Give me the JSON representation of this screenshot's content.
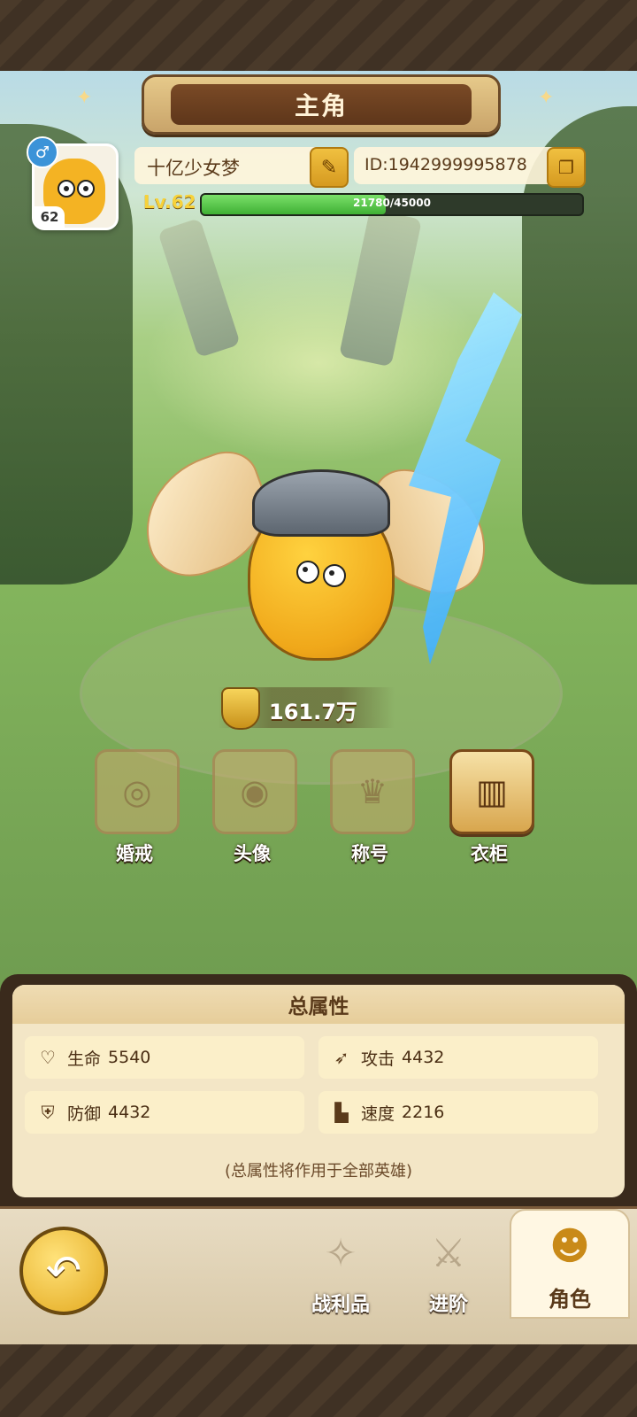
{
  "screen_title": "主角",
  "profile": {
    "name": "十亿少女梦",
    "id_text": "ID:1942999995878",
    "level_label": "Lv.62",
    "avatar_level": "62",
    "gender_symbol": "♂",
    "xp_text": "21780/45000",
    "xp_fraction": 0.484
  },
  "power": {
    "value": "161.7万"
  },
  "features": [
    {
      "label": "婚戒",
      "icon": "ring-icon",
      "active": false
    },
    {
      "label": "头像",
      "icon": "avatar-frame-icon",
      "active": false
    },
    {
      "label": "称号",
      "icon": "title-crown-icon",
      "active": false
    },
    {
      "label": "衣柜",
      "icon": "wardrobe-icon",
      "active": true
    }
  ],
  "stats_panel": {
    "title": "总属性",
    "stats": [
      {
        "label": "生命",
        "value": "5540",
        "icon": "heart-icon"
      },
      {
        "label": "攻击",
        "value": "4432",
        "icon": "attack-icon"
      },
      {
        "label": "防御",
        "value": "4432",
        "icon": "shield-icon"
      },
      {
        "label": "速度",
        "value": "2216",
        "icon": "boot-icon"
      }
    ],
    "note": "(总属性将作用于全部英雄)"
  },
  "bottom_nav": {
    "items": [
      {
        "label": "战利品",
        "icon": "loot-icon",
        "selected": false
      },
      {
        "label": "进阶",
        "icon": "advance-icon",
        "selected": false
      },
      {
        "label": "角色",
        "icon": "character-icon",
        "selected": true
      }
    ]
  },
  "colors": {
    "frame_brown": "#3a2a1c",
    "gold": "#e3a91f",
    "xp_green": "#3fb034",
    "panel_cream": "#f3e6c6"
  }
}
